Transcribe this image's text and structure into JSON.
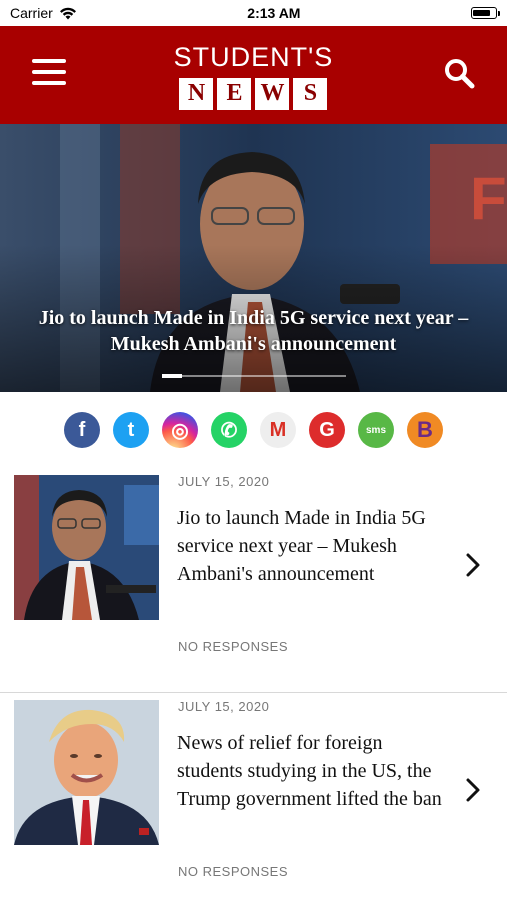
{
  "status_bar": {
    "carrier": "Carrier",
    "time": "2:13 AM",
    "battery_level": 0.85
  },
  "header": {
    "brand_top": "STUDENT'S",
    "brand_letters": [
      "N",
      "E",
      "W",
      "S"
    ],
    "background": "#a80000"
  },
  "hero": {
    "caption": "Jio to launch Made in India 5G service next year – Mukesh Ambani's announcement",
    "slide_index": 1
  },
  "share": {
    "icons": [
      {
        "name": "facebook-icon",
        "color": "#3b5998",
        "glyph": "f"
      },
      {
        "name": "twitter-icon",
        "color": "#1da1f2",
        "glyph": "t"
      },
      {
        "name": "instagram-icon",
        "color": "#d6249f",
        "glyph": "◎"
      },
      {
        "name": "whatsapp-icon",
        "color": "#25d366",
        "glyph": "✆"
      },
      {
        "name": "gmail-icon",
        "color": "#eeeeee",
        "glyph": "M"
      },
      {
        "name": "google-icon",
        "color": "#dd2c2c",
        "glyph": "G"
      },
      {
        "name": "sms-icon",
        "color": "#58b846",
        "glyph": "sms"
      },
      {
        "name": "blogger-icon",
        "color": "#f08a24",
        "glyph": "B"
      }
    ]
  },
  "articles": [
    {
      "date": "JULY 15, 2020",
      "title": "Jio to launch Made in India 5G service next year – Mukesh Ambani's announcement",
      "responses": "NO RESPONSES"
    },
    {
      "date": "JULY 15, 2020",
      "title": "News of relief for foreign students studying in the US, the Trump government lifted the ban",
      "responses": "NO RESPONSES"
    }
  ]
}
